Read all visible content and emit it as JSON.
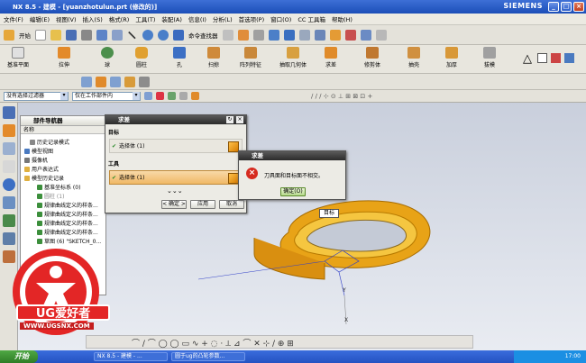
{
  "window": {
    "title": "NX 8.5 - 建模 - [yuanzhotulun.prt (修改的)]",
    "brand": "SIEMENS",
    "controls": [
      "_",
      "□",
      "×"
    ]
  },
  "menubar": [
    "文件(F)",
    "编辑(E)",
    "视图(V)",
    "插入(S)",
    "格式(R)",
    "工具(T)",
    "装配(A)",
    "信息(I)",
    "分析(L)",
    "首选项(P)",
    "窗口(O)",
    "CC 工具箱",
    "帮助(H)"
  ],
  "toolbar1": {
    "start_label": "开始",
    "command_finder": "命令查找器"
  },
  "toolbar2": [
    {
      "label": "基准平面",
      "color": "#e0e0e0"
    },
    {
      "label": "拉伸",
      "color": "#e38a2a"
    },
    {
      "label": "球",
      "color": "#4c8f4c"
    },
    {
      "label": "圆柱",
      "color": "#e0a030"
    },
    {
      "label": "孔",
      "color": "#3c6fc4"
    },
    {
      "label": "扫掠",
      "color": "#cf8a3a"
    },
    {
      "label": "阵列特征",
      "color": "#c9883a"
    },
    {
      "label": "抽取几何体",
      "color": "#d8a040"
    },
    {
      "label": "求差",
      "color": "#e08b2a"
    },
    {
      "label": "修剪体",
      "color": "#c07830"
    },
    {
      "label": "抽壳",
      "color": "#d09040"
    },
    {
      "label": "加厚",
      "color": "#d89838"
    },
    {
      "label": "拔模",
      "color": "#a0a0a0"
    }
  ],
  "filterbar": {
    "type_filter": "没有选择过滤器",
    "scope_filter": "仅在工作部件内"
  },
  "navigator": {
    "title": "部件导航器",
    "column": "名称",
    "items": [
      "历史记录模式",
      "模型视图",
      "摄像机",
      "用户表达式",
      "模型历史记录",
      "基准坐标系 (0)",
      "圆柱 (1)",
      "规律曲线定义的样条...",
      "规律曲线定义的样条...",
      "规律曲线定义的样条...",
      "规律曲线定义的样条...",
      "草图 (6) \"SKETCH_0..."
    ]
  },
  "subtract_dialog": {
    "title": "求差",
    "target_group": "目标",
    "target_row": "选择体 (1)",
    "tool_group": "工具",
    "tool_row": "选择体 (1)",
    "ok": "< 确定 >",
    "apply": "应用",
    "cancel": "取消"
  },
  "error_dialog": {
    "title": "求差",
    "message": "刀具面和目标面不相交。",
    "ok": "确定(O)"
  },
  "viewport": {
    "target_tag": "目标",
    "axis_y": "Y",
    "axis_x": "X",
    "part_color": "#e8a317"
  },
  "watermark": {
    "brand": "UG爱好者",
    "url": "WWW.UGSNX.COM"
  },
  "taskbar": {
    "start": "开始",
    "tasks": [
      "NX 8.5 - 建模 - ...",
      "圆于ug的凸轮参数..."
    ],
    "clock": "17:00"
  }
}
